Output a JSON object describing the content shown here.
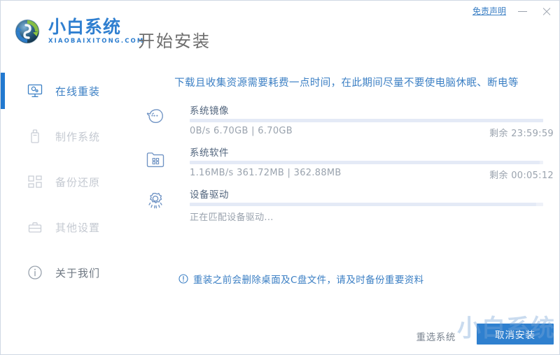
{
  "window": {
    "brand_cn": "小白系统",
    "brand_en": "XIAOBAIXITONG.COM",
    "page_title": "开始安装",
    "disclaimer_label": "免责声明",
    "minimize_label": "—",
    "close_label": "✕",
    "logo_icon": "refresh-circle-logo-icon",
    "accent_color": "#2f80cf",
    "link_color": "#3b7fc4"
  },
  "sidebar": {
    "items": [
      {
        "label": "在线重装",
        "icon": "monitor-icon",
        "state": "active"
      },
      {
        "label": "制作系统",
        "icon": "usb-drive-icon",
        "state": "disabled"
      },
      {
        "label": "备份还原",
        "icon": "grid-blocks-icon",
        "state": "disabled"
      },
      {
        "label": "其他设置",
        "icon": "toolbox-icon",
        "state": "disabled"
      },
      {
        "label": "关于我们",
        "icon": "info-circle-icon",
        "state": "about"
      }
    ]
  },
  "main": {
    "notice": "下载且收集资源需要耗费一点时间，在此期间尽量不要使电脑休眠、断电等",
    "tasks": [
      {
        "name": "系统镜像",
        "icon": "ghost-mascot-icon",
        "status": "0B/s 6.70GB | 6.70GB",
        "remaining": "剩余 23:59:59",
        "progress_percent": 100
      },
      {
        "name": "系统软件",
        "icon": "folder-apps-icon",
        "status": "1.16MB/s 361.72MB | 362.88MB",
        "remaining": "剩余 00:05:12",
        "progress_percent": 99
      },
      {
        "name": "设备驱动",
        "icon": "gear-icon",
        "status": "正在匹配设备驱动...",
        "remaining": "",
        "progress_percent": 98
      }
    ],
    "warning": {
      "icon": "exclamation-circle-icon",
      "text": "重装之前会删除桌面及C盘文件，请及时备份重要资料"
    }
  },
  "footer": {
    "reselect_label": "重选系统",
    "cancel_label": "取消安装"
  },
  "watermark": {
    "text": "小白系统"
  }
}
